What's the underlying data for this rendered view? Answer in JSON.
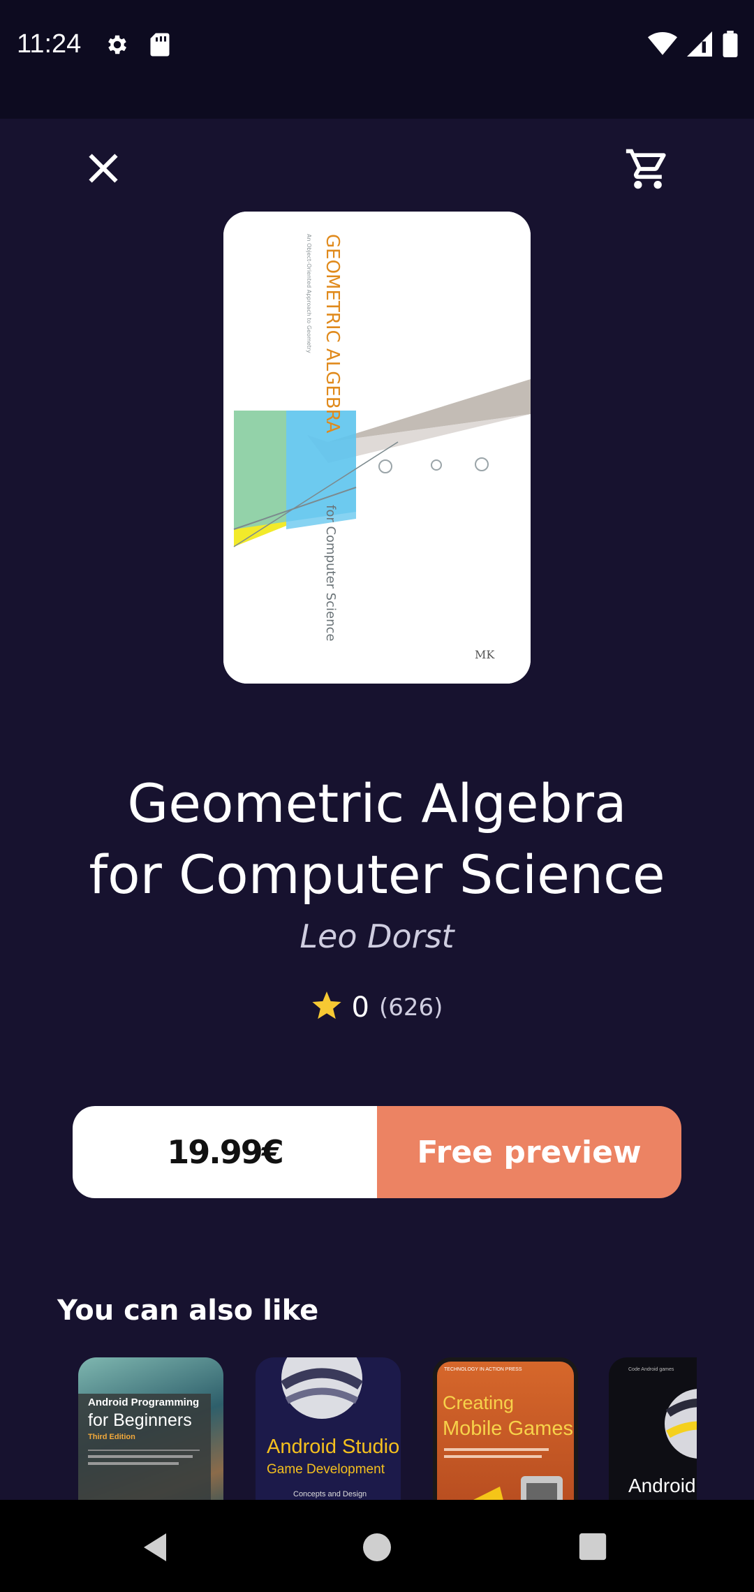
{
  "status_bar": {
    "time": "11:24",
    "icons": [
      "gear-icon",
      "sd-card-icon",
      "wifi-icon",
      "signal-icon",
      "battery-icon"
    ]
  },
  "header": {
    "icons": [
      "close-icon",
      "cart-icon"
    ]
  },
  "book": {
    "cover_title": "GEOMETRIC ALGEBRA",
    "cover_subtitle": "for Computer Science",
    "title_line1": "Geometric Algebra",
    "title_line2": "for Computer Science",
    "author": "Leo Dorst",
    "rating": "0",
    "rating_count": "(626)"
  },
  "actions": {
    "price": "19.99€",
    "preview": "Free preview"
  },
  "recommendations": {
    "title": "You can also like",
    "items": [
      {
        "line1": "Android Programming",
        "line2": "for Beginners",
        "line3": "Third Edition"
      },
      {
        "line1": "Android Studio",
        "line2": "Game Development",
        "line3": "Concepts and Design"
      },
      {
        "line1": "Creating",
        "line2": "Mobile Games"
      },
      {
        "line1": "Android A"
      }
    ]
  },
  "colors": {
    "background": "#17122f",
    "status_bar": "#0d0b20",
    "accent": "#ec8363",
    "star": "#f7c933"
  },
  "nav_bar": {
    "icons": [
      "back-icon",
      "home-icon",
      "recents-icon"
    ]
  }
}
